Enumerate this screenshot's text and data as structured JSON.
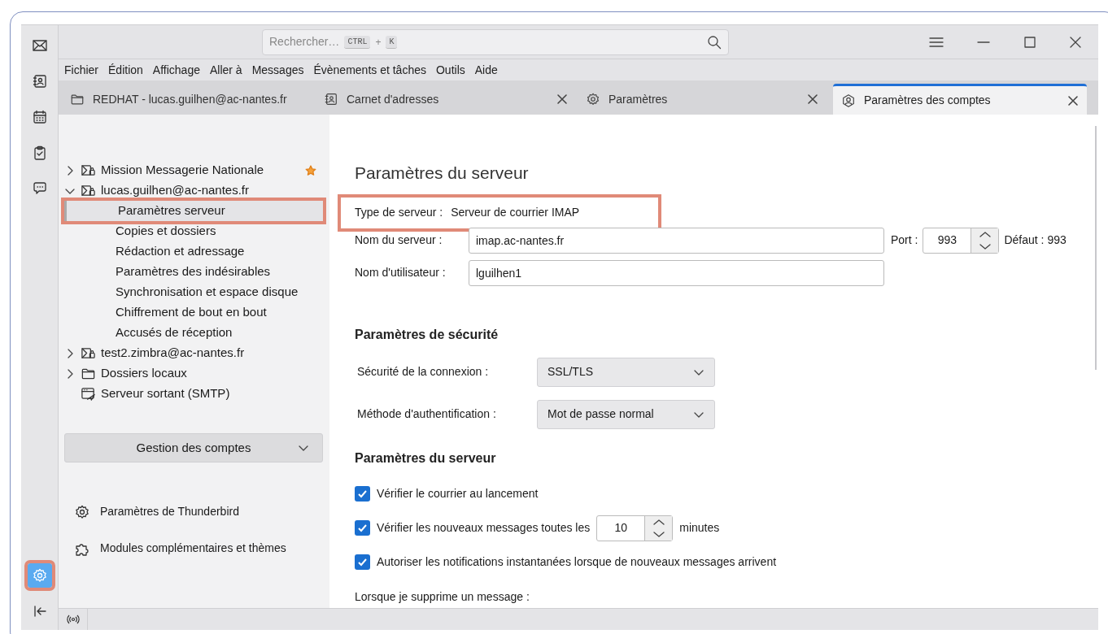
{
  "spaces_toolbar": {
    "items": [
      {
        "kind": "mail",
        "selected": false,
        "highlighted": false
      },
      {
        "kind": "contacts",
        "selected": false,
        "highlighted": false
      },
      {
        "kind": "calendar",
        "selected": false,
        "highlighted": false
      },
      {
        "kind": "tasks",
        "selected": false,
        "highlighted": false
      },
      {
        "kind": "chat",
        "selected": false,
        "highlighted": false
      }
    ],
    "bottom_items": [
      {
        "kind": "settings",
        "selected": true,
        "highlighted": true
      },
      {
        "kind": "collapse",
        "selected": false,
        "highlighted": false
      }
    ]
  },
  "search": {
    "placeholder": "Rechercher…",
    "keys": [
      "CTRL",
      "K"
    ],
    "joiner": "+"
  },
  "menu": [
    "Fichier",
    "Édition",
    "Affichage",
    "Aller à",
    "Messages",
    "Évènements et tâches",
    "Outils",
    "Aide"
  ],
  "tabs": [
    {
      "label": "REDHAT - lucas.guilhen@ac-nantes.fr",
      "kind": "folder",
      "closable": false,
      "selected": false
    },
    {
      "label": "Carnet d'adresses",
      "kind": "contacts",
      "closable": true,
      "selected": false
    },
    {
      "label": "Paramètres",
      "kind": "gear",
      "closable": true,
      "selected": false
    },
    {
      "label": "Paramètres des comptes",
      "kind": "account",
      "closable": true,
      "selected": true
    }
  ],
  "account_tree": [
    {
      "label": "Mission Messagerie Nationale",
      "kind": "mail-account",
      "expanded": false,
      "starred": true
    },
    {
      "label": "lucas.guilhen@ac-nantes.fr",
      "kind": "mail-account",
      "expanded": true,
      "starred": false,
      "children": [
        {
          "label": "Paramètres serveur",
          "selected": true,
          "highlighted": true
        },
        {
          "label": "Copies et dossiers",
          "selected": false,
          "highlighted": false
        },
        {
          "label": "Rédaction et adressage",
          "selected": false,
          "highlighted": false
        },
        {
          "label": "Paramètres des indésirables",
          "selected": false,
          "highlighted": false
        },
        {
          "label": "Synchronisation et espace disque",
          "selected": false,
          "highlighted": false
        },
        {
          "label": "Chiffrement de bout en bout",
          "selected": false,
          "highlighted": false
        },
        {
          "label": "Accusés de réception",
          "selected": false,
          "highlighted": false
        }
      ]
    },
    {
      "label": "test2.zimbra@ac-nantes.fr",
      "kind": "mail-account",
      "expanded": false,
      "starred": false
    },
    {
      "label": "Dossiers locaux",
      "kind": "folder",
      "expanded": false,
      "starred": false
    },
    {
      "label": "Serveur sortant (SMTP)",
      "kind": "outgoing",
      "starred": false
    }
  ],
  "account_actions": {
    "label": "Gestion des comptes"
  },
  "footer_links": [
    {
      "kind": "gear",
      "label": "Paramètres de Thunderbird"
    },
    {
      "kind": "puzzle",
      "label": "Modules complémentaires et thèmes"
    }
  ],
  "page": {
    "title": "Paramètres du serveur",
    "server_type": {
      "label": "Type de serveur :",
      "value": "Serveur de courrier IMAP",
      "highlighted": true
    },
    "server_name": {
      "label": "Nom du serveur :",
      "value": "imap.ac-nantes.fr"
    },
    "port": {
      "label": "Port :",
      "value": "993",
      "default": "Défaut : 993"
    },
    "username": {
      "label": "Nom d'utilisateur :",
      "value": "lguilhen1"
    },
    "security_heading": "Paramètres de sécurité",
    "selects": [
      {
        "label": "Sécurité de la connexion :",
        "value": "SSL/TLS"
      },
      {
        "label": "Méthode d'authentification :",
        "value": "Mot de passe normal"
      }
    ],
    "server_heading": "Paramètres du serveur",
    "checkboxes": [
      {
        "kind": "plain",
        "label": "Vérifier le courrier au lancement",
        "checked": true
      },
      {
        "kind": "interval",
        "label": "Vérifier les nouveaux messages toutes les",
        "checked": true,
        "value": "10",
        "suffix": "minutes"
      },
      {
        "kind": "plain",
        "label": "Autoriser les notifications instantanées lorsque de nouveaux messages arrivent",
        "checked": true
      }
    ],
    "delete_label": "Lorsque je supprime un message :"
  }
}
